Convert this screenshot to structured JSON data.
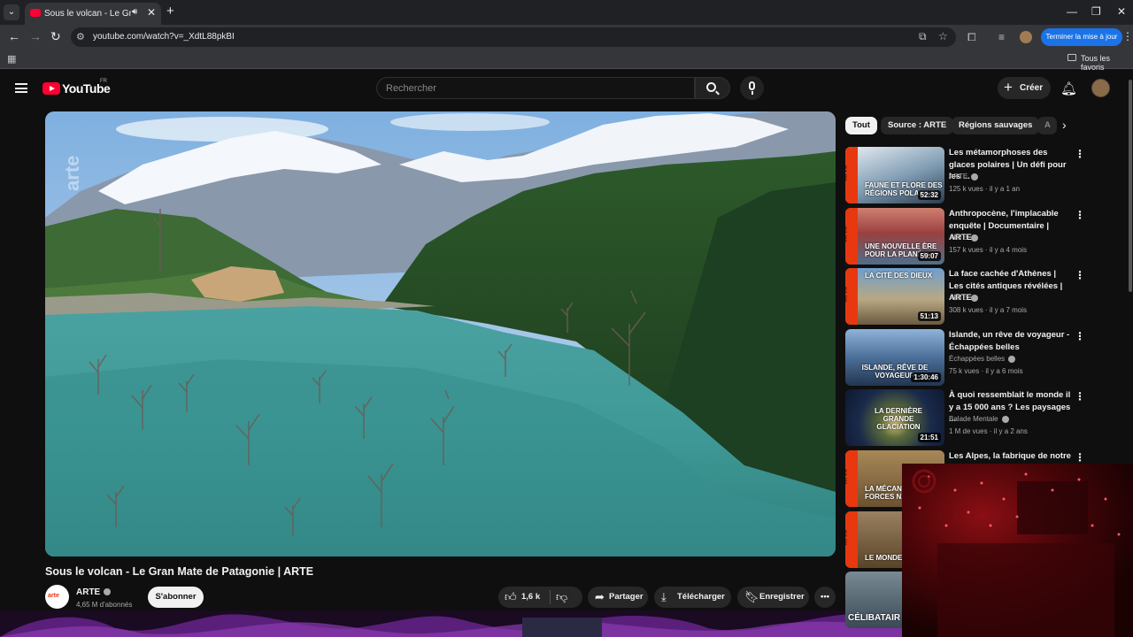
{
  "browser": {
    "tab_title": "Sous le volcan - Le Gran Mate de Patagonie | ARTE",
    "url": "youtube.com/watch?v=_XdtL88pkBI",
    "update_button": "Terminer la mise à jour",
    "bookmark_folder": "Tous les favoris"
  },
  "masthead": {
    "logo_text": "YouTube",
    "region": "FR",
    "search_placeholder": "Rechercher",
    "create_label": "Créer"
  },
  "video": {
    "title": "Sous le volcan - Le Gran Mate de Patagonie | ARTE",
    "watermark": "arte",
    "channel": "ARTE",
    "channel_logo": "arte",
    "subscribers": "4,65 M d'abonnés",
    "subscribe_label": "S'abonner",
    "likes": "1,6 k",
    "share_label": "Partager",
    "download_label": "Télécharger",
    "save_label": "Enregistrer"
  },
  "chips": [
    "Tout",
    "Source : ARTE",
    "Régions sauvages",
    "A"
  ],
  "recommendations": [
    {
      "title": "Les métamorphoses des glaces polaires | Un défi pour les ...",
      "channel": "ARTE",
      "views": "125 k vues",
      "age": "il y a 1 an",
      "duration": "52:32",
      "thumb_text": "Faune et flore des régions polaires",
      "thumb_color": "#5f7f99"
    },
    {
      "title": "Anthropocène, l'implacable enquête | Documentaire | ARTE",
      "channel": "ARTE",
      "views": "157 k vues",
      "age": "il y a 4 mois",
      "duration": "59:07",
      "thumb_text": "Une nouvelle ère pour la planète",
      "thumb_color": "#b0493e"
    },
    {
      "title": "La face cachée d'Athènes | Les cités antiques révélées | ARTE",
      "channel": "ARTE",
      "views": "308 k vues",
      "age": "il y a 7 mois",
      "duration": "51:13",
      "thumb_text": "La cité des dieux",
      "thumb_color": "#8a7a5c"
    },
    {
      "title": "Islande, un rêve de voyageur - Échappées belles",
      "channel": "Échappées belles",
      "views": "75 k vues",
      "age": "il y a 6 mois",
      "duration": "1:30:46",
      "thumb_text": "Islande, rêve de voyageur",
      "thumb_color": "#4c6f99"
    },
    {
      "title": "À quoi ressemblait le monde il y a 15 000 ans ? Les paysages ...",
      "channel": "Balade Mentale",
      "views": "1 M de vues",
      "age": "il y a 2 ans",
      "duration": "21:51",
      "thumb_text": "La dernière grande glaciation",
      "thumb_color": "#2b3f66"
    },
    {
      "title": "Les Alpes, la fabrique de notre",
      "thumb_text": "La mécanique des forces naturelles",
      "thumb_color": "#8c6a3c"
    },
    {
      "thumb_text": "Le monde des rats",
      "thumb_color": "#7a6040"
    },
    {
      "thumb_text": "Célibatair",
      "thumb_color": "#4a5a66"
    }
  ],
  "colors": {
    "background": "#0f0f0f",
    "yt_red": "#ff0033",
    "arte_orange": "#e8380f",
    "update_blue": "#1a73e8"
  }
}
